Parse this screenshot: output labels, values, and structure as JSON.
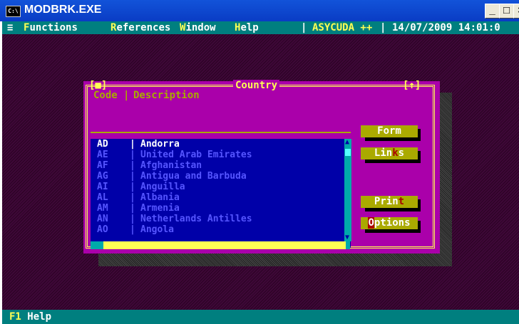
{
  "window": {
    "title": "MODBRK.EXE",
    "icon_text": "C:\\",
    "buttons": {
      "minimize": "_",
      "maximize": "□",
      "close": "×"
    }
  },
  "menu": {
    "system": "≡",
    "items": [
      {
        "hotkey": "F",
        "rest": "unctions"
      },
      {
        "hotkey": "R",
        "rest": "eferences"
      },
      {
        "hotkey": "W",
        "rest": "indow"
      },
      {
        "hotkey": "H",
        "rest": "elp"
      }
    ],
    "app": "ASYCUDA ++",
    "datetime": "14/07/2009 14:01:0"
  },
  "dialog": {
    "title": "Country",
    "close_marker": "[■]",
    "zoom_marker": "[↑]",
    "columns": {
      "code": "Code",
      "description": "Description"
    },
    "rows": [
      {
        "code": "AD",
        "description": "Andorra"
      },
      {
        "code": "AE",
        "description": "United Arab Emirates"
      },
      {
        "code": "AF",
        "description": "Afghanistan"
      },
      {
        "code": "AG",
        "description": "Antigua and Barbuda"
      },
      {
        "code": "AI",
        "description": "Anguilla"
      },
      {
        "code": "AL",
        "description": "Albania"
      },
      {
        "code": "AM",
        "description": "Armenia"
      },
      {
        "code": "AN",
        "description": "Netherlands Antilles"
      },
      {
        "code": "AO",
        "description": "Angola"
      }
    ],
    "buttons": [
      {
        "id": "form",
        "pre": "Form",
        "hk": "",
        "post": ""
      },
      {
        "id": "links",
        "pre": "Lin",
        "hk": "k",
        "post": "s"
      },
      {
        "id": "print",
        "pre": "Prin",
        "hk": "t",
        "post": ""
      },
      {
        "id": "options",
        "pre": "",
        "hk": "O",
        "post": "ptions"
      }
    ]
  },
  "status": {
    "key": "F1",
    "label": "Help"
  },
  "colors": {
    "desktop": "#33002a",
    "menubar": "#007f7f",
    "dialog": "#aa00aa",
    "list": "#0000a8",
    "frame": "#ffff54",
    "button": "#aaaa00"
  }
}
